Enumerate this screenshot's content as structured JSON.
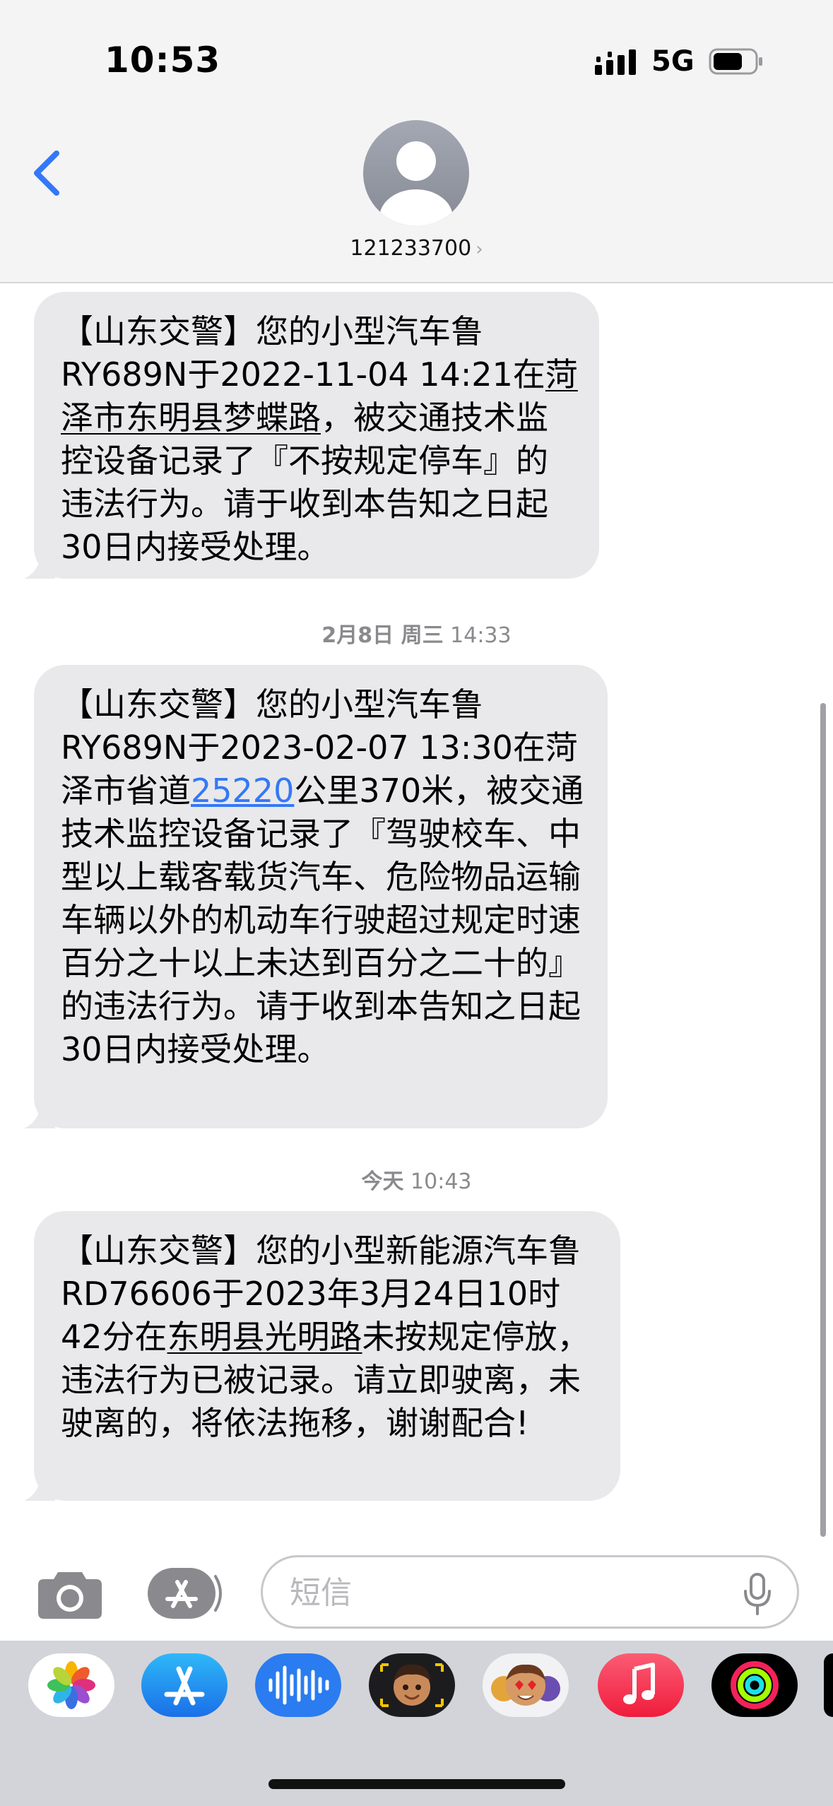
{
  "status_bar": {
    "time": "10:53",
    "network": "5G"
  },
  "header": {
    "contact": "121233700",
    "contact_chevron": "›"
  },
  "messages": [
    {
      "parts": [
        "【山东交警】您的小型汽车鲁RY689N于2022-11-04 14:21在",
        "菏泽市东明县梦蝶路",
        "，被交通技术监控设备记录了『不按规定停车』的违法行为。请于收到本告知之日起30日内接受处理。"
      ]
    },
    {
      "timestamp_date": "2月8日 周三",
      "timestamp_time": "14:33",
      "parts": [
        "【山东交警】您的小型汽车鲁RY689N于2023-02-07 13:30在菏泽市省道",
        "25220",
        "公里370米，被交通技术监控设备记录了『驾驶校车、中型以上载客载货汽车、危险物品运输车辆以外的机动车行驶超过规定时速百分之十以上未达到百分之二十的』的违法行为。请于收到本告知之日起30日内接受处理。"
      ]
    },
    {
      "timestamp_date": "今天",
      "timestamp_time": "10:43",
      "parts": [
        "【山东交警】您的小型新能源汽车鲁RD76606于2023年3月24日10时42分在",
        "东明县光明路",
        "未按规定停放，违法行为已被记录。请立即驶离，未驶离的，将依法拖移，谢谢配合!"
      ]
    }
  ],
  "input": {
    "placeholder": "短信"
  },
  "apps": [
    "photos-app",
    "app-store-app",
    "audio-message-app",
    "memoji-app",
    "animoji-stickers-app",
    "music-app",
    "fitness-app"
  ],
  "colors": {
    "bubble": "#e9e9eb",
    "link": "#3478f6",
    "accent": "#3478f6"
  }
}
